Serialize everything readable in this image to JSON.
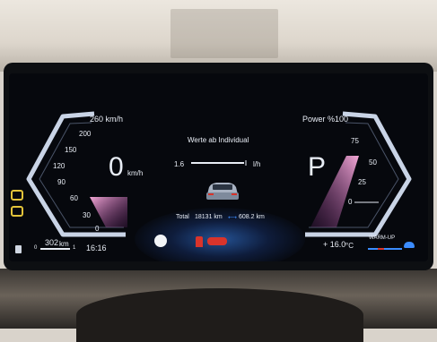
{
  "speedometer": {
    "max_label": "260 km/h",
    "ticks": [
      "200",
      "150",
      "120",
      "90",
      "60",
      "30",
      "0"
    ],
    "speed": "0",
    "speed_unit": "km/h"
  },
  "power_meter": {
    "header": "Power %100",
    "ticks": [
      "75",
      "50",
      "25",
      "0"
    ]
  },
  "gear": "P",
  "center": {
    "title": "Werte ab Individual",
    "consumption_value": "1.6",
    "consumption_unit": "l/h",
    "total_label": "Total",
    "total_value": "18131 km",
    "trip_value": "608.2 km"
  },
  "bottom_left": {
    "range_value": "302",
    "range_unit": "km",
    "gauge_start": "0",
    "gauge_end": "1",
    "time": "16:16"
  },
  "bottom_right": {
    "temperature": "+ 16.0",
    "temperature_unit": "°C",
    "warmup_label": "WARM-UP"
  },
  "colors": {
    "accent_blue": "#3b8cff",
    "warning_red": "#d8342b",
    "pink_glow": "#ff9ad6",
    "indicator_green": "#e3c43a"
  }
}
